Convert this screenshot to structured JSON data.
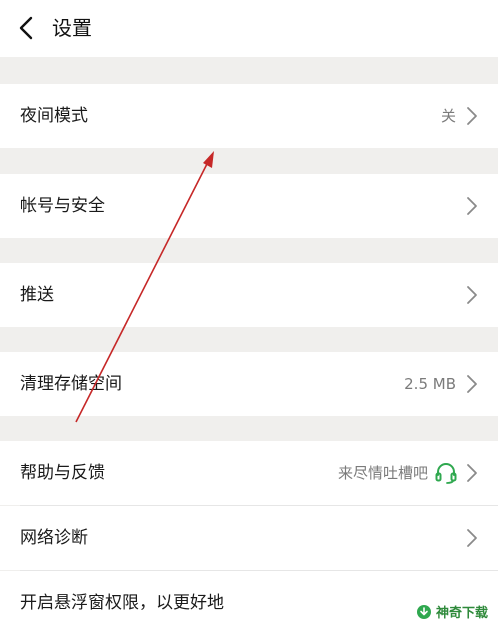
{
  "header": {
    "title": "设置"
  },
  "settings": {
    "night_mode": {
      "label": "夜间模式",
      "value": "关"
    },
    "account_security": {
      "label": "帐号与安全"
    },
    "push": {
      "label": "推送"
    },
    "clear_storage": {
      "label": "清理存储空间",
      "value": "2.5 MB"
    },
    "help_feedback": {
      "label": "帮助与反馈",
      "value": "来尽情吐槽吧"
    },
    "network_diagnosis": {
      "label": "网络诊断"
    },
    "floating_window": {
      "label": "开启悬浮窗权限，以更好地"
    }
  },
  "watermark": {
    "text": "神奇下载"
  },
  "colors": {
    "accent_green": "#2fa84f",
    "arrow_red": "#c62828",
    "background": "#f0efed"
  }
}
